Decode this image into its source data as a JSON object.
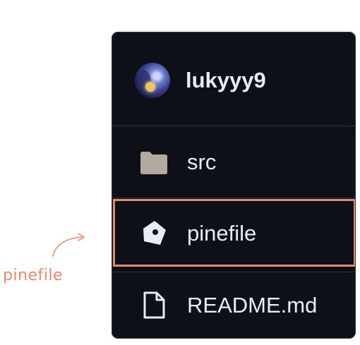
{
  "profile": {
    "username": "lukyyy9",
    "avatar": "avatar-image"
  },
  "files": [
    {
      "name": "src",
      "icon": "folder-icon",
      "type": "directory",
      "highlighted": false
    },
    {
      "name": "pinefile",
      "icon": "pine-icon",
      "type": "file",
      "highlighted": true
    },
    {
      "name": "README.md",
      "icon": "file-icon",
      "type": "file",
      "highlighted": false
    }
  ],
  "annotation": {
    "label": "pinefile",
    "color": "#e8896b"
  },
  "colors": {
    "panel_background": "#0d1117",
    "panel_border": "#30363d",
    "text": "#e6edf3",
    "folder": "#b3a99f",
    "highlight": "#e4896b"
  }
}
